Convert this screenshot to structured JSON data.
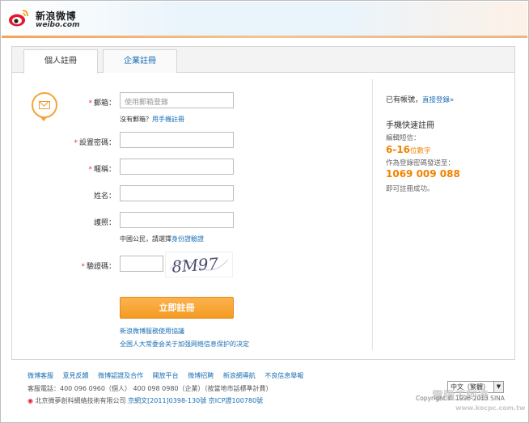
{
  "header": {
    "logo_cn": "新浪微博",
    "logo_en": "weibo.com"
  },
  "tabs": [
    {
      "label": "個人註冊",
      "active": true
    },
    {
      "label": "企業註冊",
      "active": false
    }
  ],
  "form": {
    "email": {
      "label": "郵箱：",
      "required": true,
      "placeholder": "使用郵箱登錄"
    },
    "no_email_hint": "沒有郵箱？",
    "no_email_link": "用手機註冊",
    "password": {
      "label": "設置密碼：",
      "required": true
    },
    "nickname": {
      "label": "暱稱：",
      "required": true
    },
    "name": {
      "label": "姓名：",
      "required": false
    },
    "id_card": {
      "label": "護照：",
      "required": false
    },
    "id_hint": "中國公民，請選擇",
    "id_link": "身份證驗證",
    "captcha": {
      "label": "驗證碼：",
      "required": true,
      "image_text": "8M97"
    },
    "submit_label": "立即註冊",
    "agreement_1": "新浪微博服務使用協議",
    "agreement_2": "全国人大常委会关于加强网络信息保护的决定"
  },
  "sidebar": {
    "have_account": "已有帳號，",
    "login_link": "直接登錄»",
    "title": "手機快速註冊",
    "step1": "編輯短信：",
    "digits": "6-16",
    "digits_suffix": "位數字",
    "step2": "作為登錄密碼發送至：",
    "phone_number": "1069 009 088",
    "step3": "即可註冊成功。"
  },
  "footer": {
    "links": [
      "微博客服",
      "意見反饋",
      "微博認證及合作",
      "開放平台",
      "微博招聘",
      "新浪網導航",
      "不良信息舉報"
    ],
    "hotline": "客服電話：400 096 0960（個人） 400 098 0980（企業）（按當地市話標準計費）",
    "company": "北京微夢創科網絡技術有限公司",
    "icp1": "京網文[2011]0398-130號",
    "icp2": "京ICP證100780號",
    "language": "中文（繁體）",
    "copyright": "Copyright © 1996-2013 SINA",
    "watermark_url": "www.kocpc.com.tw"
  },
  "colors": {
    "accent_orange": "#f49a22",
    "link_blue": "#1a6eb4",
    "required_red": "#ee3333"
  }
}
